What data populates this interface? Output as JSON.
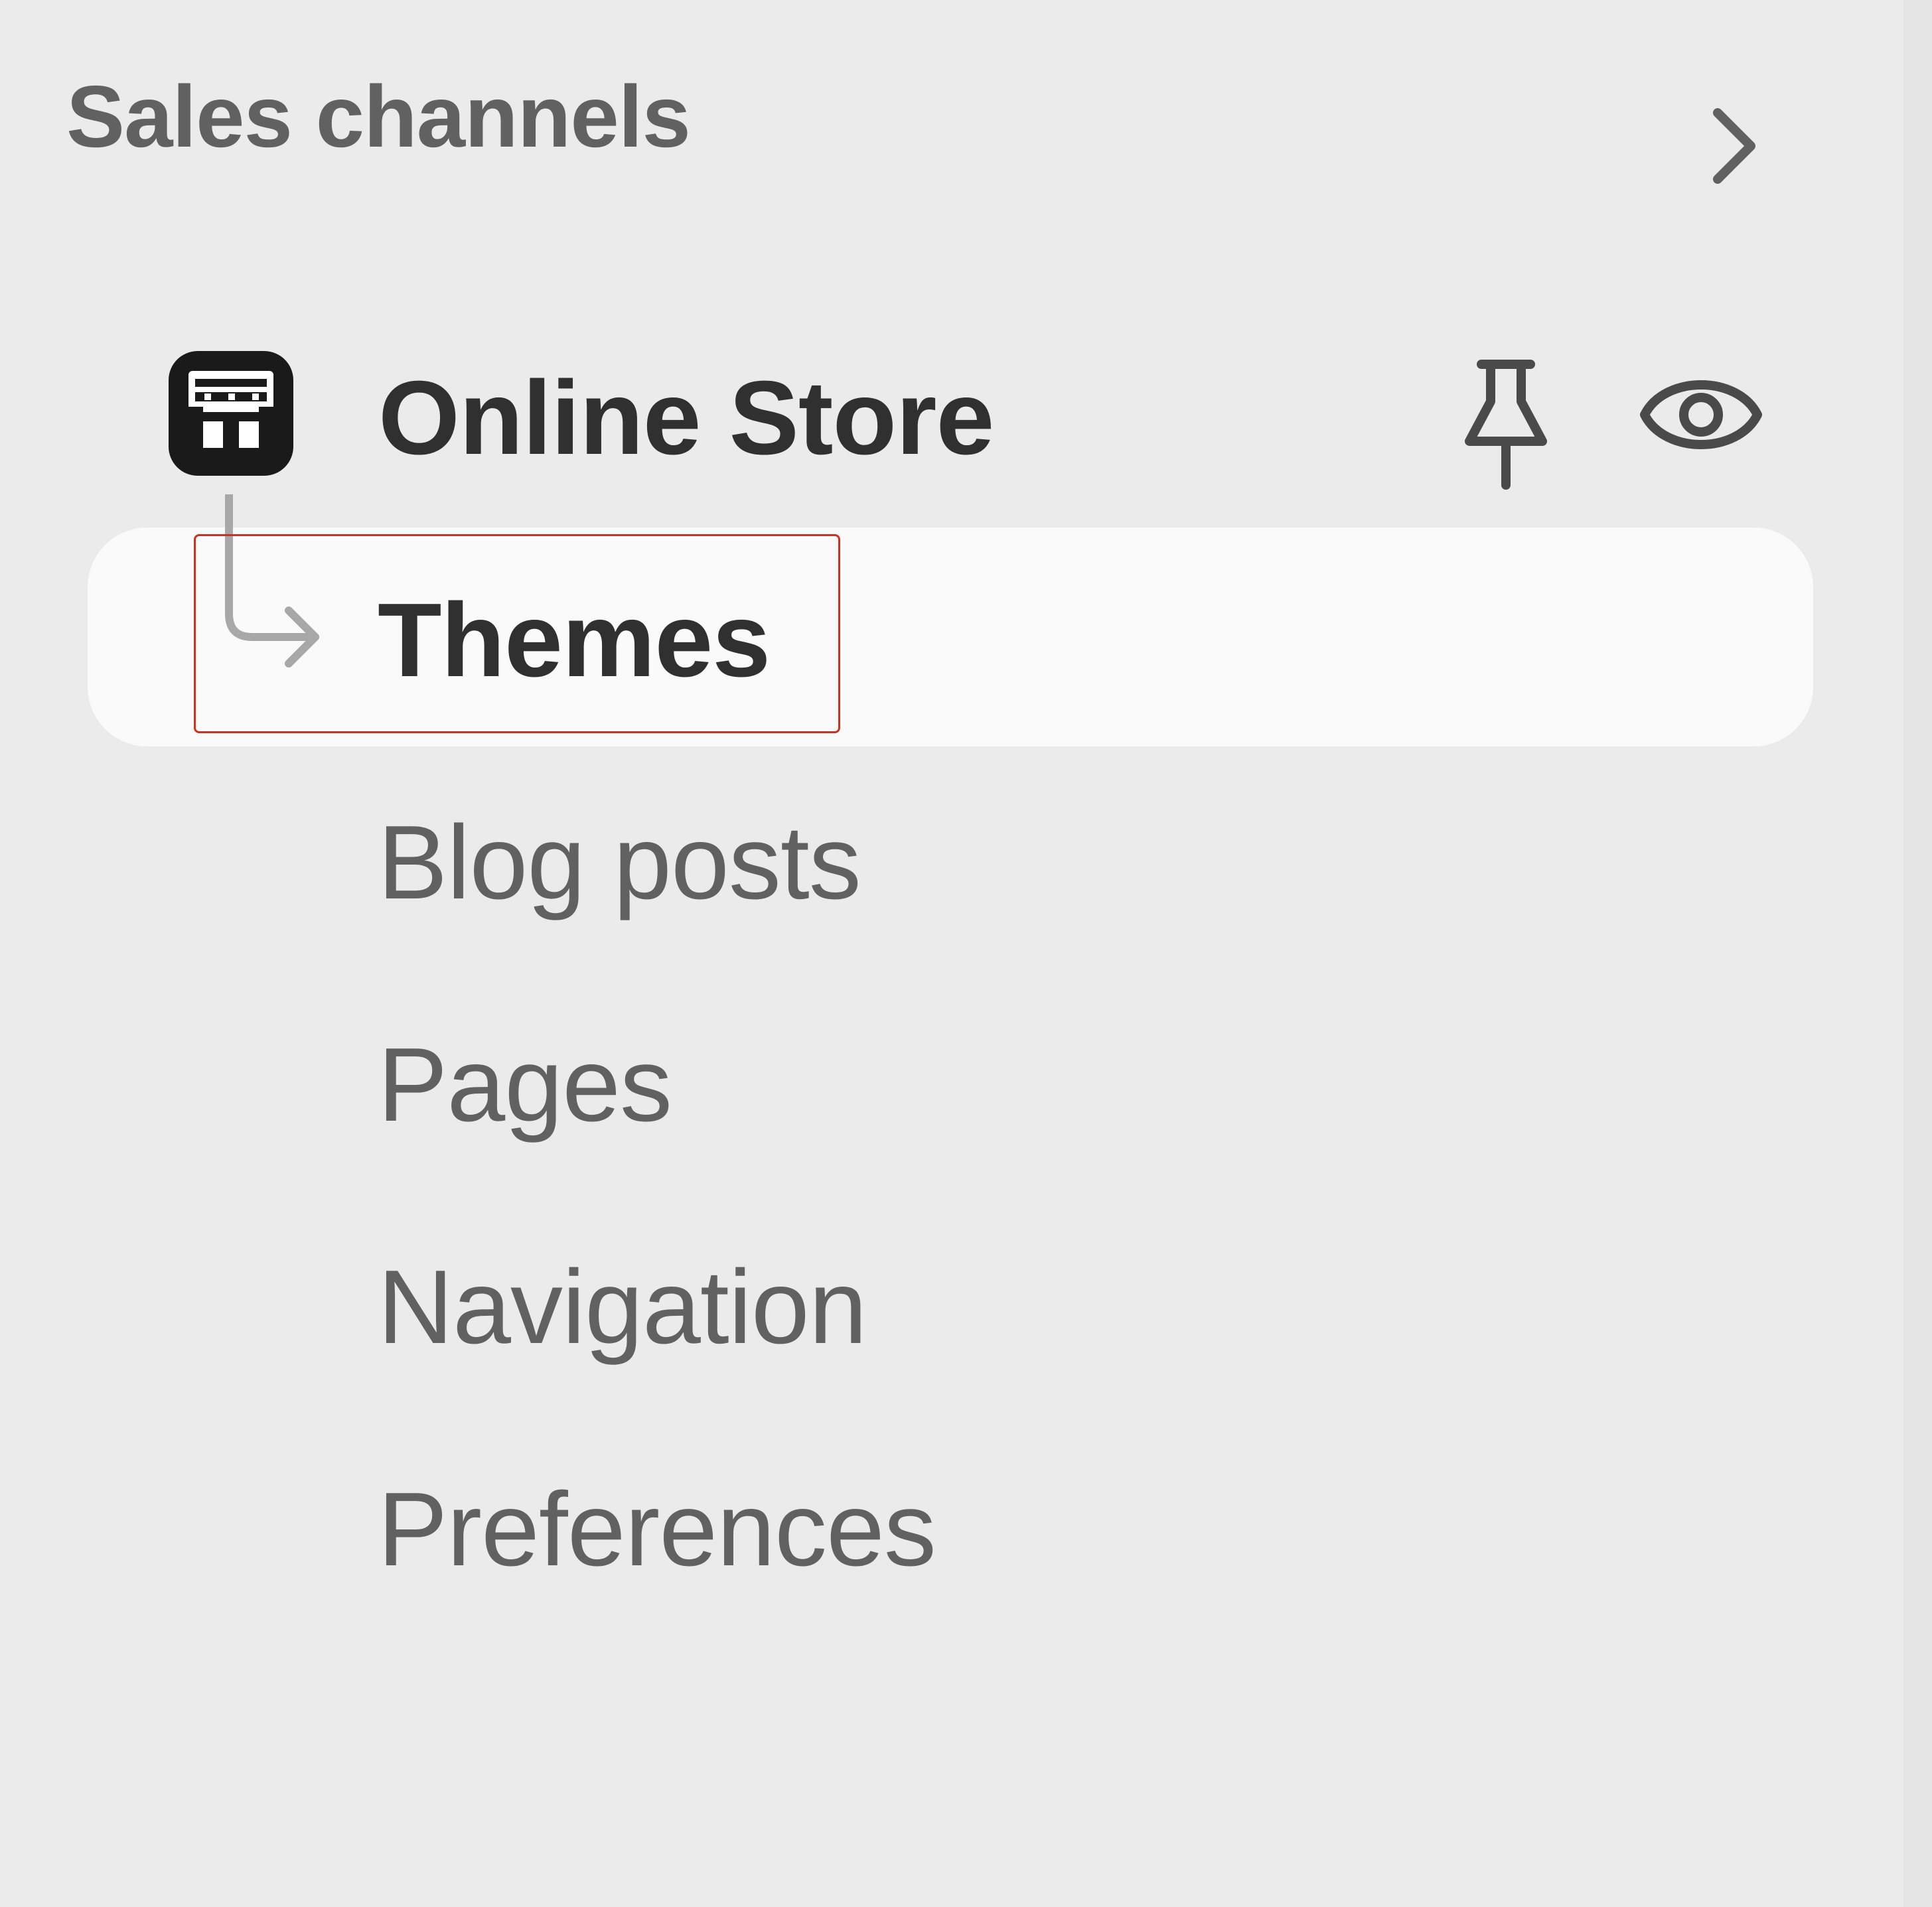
{
  "sidebar": {
    "section_title": "Sales channels",
    "channel": {
      "label": "Online Store",
      "icon": "store-icon",
      "actions": [
        "pin-icon",
        "eye-icon"
      ]
    },
    "items": [
      {
        "label": "Themes",
        "active": true
      },
      {
        "label": "Blog posts",
        "active": false
      },
      {
        "label": "Pages",
        "active": false
      },
      {
        "label": "Navigation",
        "active": false
      },
      {
        "label": "Preferences",
        "active": false
      }
    ]
  },
  "colors": {
    "background": "#ebebeb",
    "active_bg": "#fafafa",
    "text_primary": "#303030",
    "text_secondary": "#616161",
    "highlight": "#d0311f"
  }
}
